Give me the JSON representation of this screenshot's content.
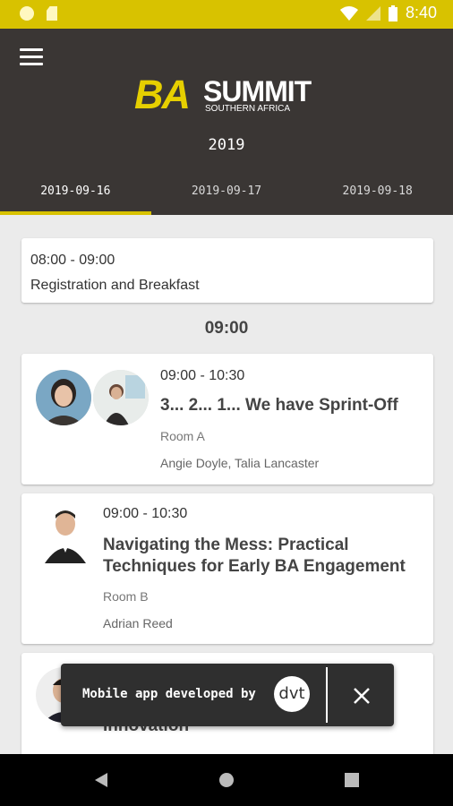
{
  "status_bar": {
    "time": "8:40"
  },
  "header": {
    "logo_ba": "BA",
    "logo_summit": "SUMMIT",
    "logo_region": "SOUTHERN AFRICA",
    "year": "2019"
  },
  "tabs": [
    {
      "label": "2019-09-16",
      "active": true
    },
    {
      "label": "2019-09-17",
      "active": false
    },
    {
      "label": "2019-09-18",
      "active": false
    }
  ],
  "schedule": {
    "registration": {
      "time": "08:00 - 09:00",
      "title": "Registration and Breakfast"
    },
    "section_time": "09:00",
    "sessions": [
      {
        "time": "09:00 - 10:30",
        "title": "3... 2... 1... We have Sprint-Off",
        "room": "Room A",
        "speakers": "Angie Doyle, Talia Lancaster"
      },
      {
        "time": "09:00 - 10:30",
        "title_line1": "Navigating the Mess: Practical",
        "title_line2": "Techniques for Early BA Engagement",
        "room": "Room B",
        "speakers": "Adrian Reed"
      },
      {
        "title_partial": "Innovation"
      }
    ]
  },
  "toast": {
    "text": "Mobile app developed by",
    "logo": "dvt"
  },
  "colors": {
    "accent": "#d8c200",
    "appbar": "#3a3634",
    "background": "#ebebeb"
  }
}
